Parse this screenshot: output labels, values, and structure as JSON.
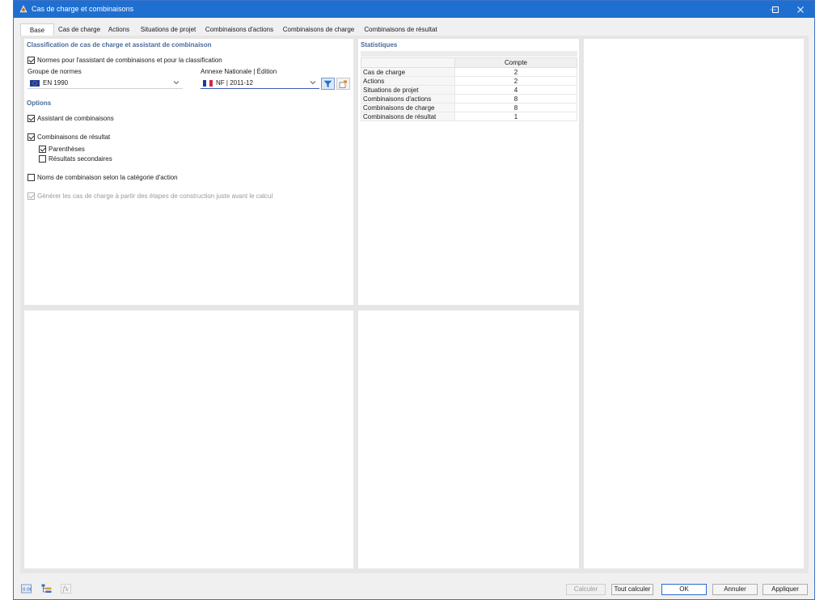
{
  "window": {
    "title": "Cas de charge et combinaisons",
    "accent": "#1f6fd0"
  },
  "tabs": [
    {
      "label": "Base",
      "active": true
    },
    {
      "label": "Cas de charge"
    },
    {
      "label": "Actions"
    },
    {
      "label": "Situations de projet"
    },
    {
      "label": "Combinaisons d'actions"
    },
    {
      "label": "Combinaisons de charge"
    },
    {
      "label": "Combinaisons de résultat"
    }
  ],
  "classification": {
    "title": "Classification de cas de charge et assistant de combinaison",
    "norms_checkbox_label": "Normes pour l'assistant de combinaisons et pour la classification",
    "norms_checked": true,
    "norm_group_label": "Groupe de normes",
    "norm_group_value": "EN 1990",
    "national_annex_label": "Annexe Nationale | Édition",
    "national_annex_value": "NF | 2011-12"
  },
  "options": {
    "title": "Options",
    "items": [
      {
        "label": "Assistant de combinaisons",
        "checked": true
      },
      {
        "label": "Combinaisons de résultat",
        "checked": true
      },
      {
        "label": "Parenthèses",
        "checked": true
      },
      {
        "label": "Résultats secondaires",
        "checked": false
      },
      {
        "label": "Noms de combinaison selon la catégorie d'action",
        "checked": false
      },
      {
        "label": "Générer les cas de charge à partir des étapes de construction juste avant le calcul",
        "checked": true,
        "disabled": true
      }
    ]
  },
  "statistics": {
    "title": "Statistiques",
    "column_header": "Compte",
    "rows": [
      {
        "name": "Cas de charge",
        "count": "2"
      },
      {
        "name": "Actions",
        "count": "2"
      },
      {
        "name": "Situations de projet",
        "count": "4"
      },
      {
        "name": "Combinaisons d'actions",
        "count": "8"
      },
      {
        "name": "Combinaisons de charge",
        "count": "8"
      },
      {
        "name": "Combinaisons de résultat",
        "count": "1"
      }
    ]
  },
  "footer": {
    "tool_icons": [
      "units-icon",
      "tree-list-icon",
      "formula-icon"
    ],
    "buttons": {
      "calculate": "Calculer",
      "calculate_all": "Tout calculer",
      "ok": "OK",
      "cancel": "Annuler",
      "apply": "Appliquer"
    }
  }
}
